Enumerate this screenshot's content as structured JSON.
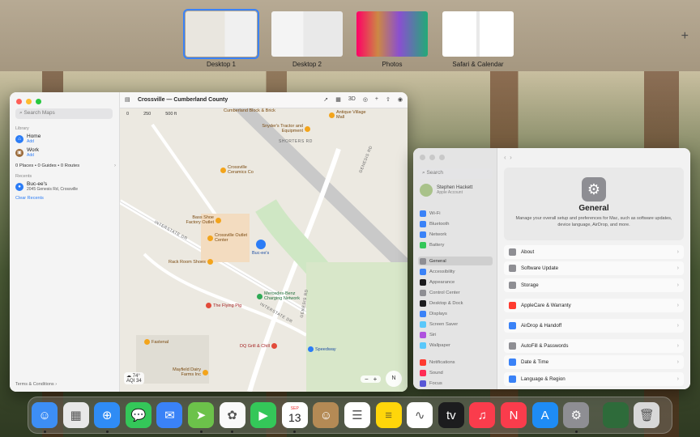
{
  "spaces": [
    {
      "label": "Desktop 1",
      "active": true
    },
    {
      "label": "Desktop 2",
      "active": false
    },
    {
      "label": "Photos",
      "active": false
    },
    {
      "label": "Safari & Calendar",
      "active": false
    }
  ],
  "add_space_icon": "+",
  "maps": {
    "search_placeholder": "Search Maps",
    "library_label": "Library",
    "home": {
      "label": "Home",
      "sub": "Add"
    },
    "work": {
      "label": "Work",
      "sub": "Add"
    },
    "counts": "0 Places • 0 Guides • 0 Routes",
    "recents_label": "Recents",
    "recent": {
      "label": "Buc-ee's",
      "sub": "2045 Genesis Rd, Crossville"
    },
    "clear_recents": "Clear Recents",
    "terms": "Terms & Conditions ›",
    "title": "Crossville — Cumberland County",
    "toolbar_3d": "3D",
    "scale": [
      "0",
      "250",
      "500 ft"
    ],
    "weather_temp": "74°",
    "weather_aqi": "AQI 34",
    "compass": "N",
    "zoom_minus": "−",
    "zoom_plus": "+",
    "pois": [
      {
        "label": "Cumberland Block & Brick",
        "kind": "orange"
      },
      {
        "label": "Antique Village Mall",
        "kind": "orange"
      },
      {
        "label": "Snyder's Tractor and Equipment",
        "kind": "orange"
      },
      {
        "label": "Crossville Ceramics Co",
        "kind": "orange"
      },
      {
        "label": "Bass Shoe Factory Outlet",
        "kind": "orange"
      },
      {
        "label": "Crossville Outlet Center",
        "kind": "orange"
      },
      {
        "label": "Buc-ee's",
        "kind": "blue"
      },
      {
        "label": "Rack Room Shoes",
        "kind": "orange"
      },
      {
        "label": "Mercedes-Benz Charging Network",
        "kind": "green"
      },
      {
        "label": "The Flying Pig",
        "kind": "red"
      },
      {
        "label": "Fastenal",
        "kind": "orange"
      },
      {
        "label": "DQ Grill & Chill",
        "kind": "red"
      },
      {
        "label": "Speedway",
        "kind": "blue"
      },
      {
        "label": "Mayfield Dairy Farms Inc",
        "kind": "orange"
      }
    ],
    "roads": [
      "INTERSTATE DR",
      "GENESIS RD",
      "INTERSTATE DR",
      "GENESIS RD",
      "SHORTERS RD"
    ]
  },
  "settings": {
    "search_placeholder": "Search",
    "user": {
      "name": "Stephen Hackett",
      "sub": "Apple Account"
    },
    "sidebar": [
      {
        "label": "Wi-Fi",
        "color": "#3a82f7"
      },
      {
        "label": "Bluetooth",
        "color": "#3a82f7"
      },
      {
        "label": "Network",
        "color": "#3a82f7"
      },
      {
        "label": "Battery",
        "color": "#34c759"
      },
      {
        "label": "General",
        "color": "#8e8e93",
        "selected": true
      },
      {
        "label": "Accessibility",
        "color": "#3a82f7"
      },
      {
        "label": "Appearance",
        "color": "#1c1c1e"
      },
      {
        "label": "Control Center",
        "color": "#8e8e93"
      },
      {
        "label": "Desktop & Dock",
        "color": "#1c1c1e"
      },
      {
        "label": "Displays",
        "color": "#3a82f7"
      },
      {
        "label": "Screen Saver",
        "color": "#5ac8fa"
      },
      {
        "label": "Siri",
        "color": "#af52de"
      },
      {
        "label": "Wallpaper",
        "color": "#5ac8fa"
      },
      {
        "label": "Notifications",
        "color": "#ff3b30"
      },
      {
        "label": "Sound",
        "color": "#ff2d55"
      },
      {
        "label": "Focus",
        "color": "#5856d6"
      }
    ],
    "title": "General",
    "description": "Manage your overall setup and preferences for Mac, such as software updates, device language, AirDrop, and more.",
    "rows": [
      {
        "label": "About",
        "color": "#8e8e93"
      },
      {
        "label": "Software Update",
        "color": "#8e8e93"
      },
      {
        "label": "Storage",
        "color": "#8e8e93"
      },
      {
        "label": "AppleCare & Warranty",
        "color": "#ff3b30"
      },
      {
        "label": "AirDrop & Handoff",
        "color": "#3a82f7"
      },
      {
        "label": "AutoFill & Passwords",
        "color": "#8e8e93"
      },
      {
        "label": "Date & Time",
        "color": "#3a82f7"
      },
      {
        "label": "Language & Region",
        "color": "#3a82f7"
      }
    ]
  },
  "dock": [
    {
      "name": "finder",
      "color": "#3d8ef5",
      "glyph": "☺",
      "running": true
    },
    {
      "name": "launchpad",
      "color": "#e8e8e8",
      "glyph": "▦",
      "running": false
    },
    {
      "name": "safari",
      "color": "#2f8cf5",
      "glyph": "⊕",
      "running": true
    },
    {
      "name": "messages",
      "color": "#34c759",
      "glyph": "💬",
      "running": false
    },
    {
      "name": "mail",
      "color": "#3a82f7",
      "glyph": "✉",
      "running": false
    },
    {
      "name": "maps",
      "color": "#6cc24a",
      "glyph": "➤",
      "running": true
    },
    {
      "name": "photos",
      "color": "#fafafa",
      "glyph": "✿",
      "running": true
    },
    {
      "name": "facetime",
      "color": "#34c759",
      "glyph": "▶",
      "running": false
    },
    {
      "name": "calendar",
      "color": "#ffffff",
      "glyph": "",
      "month": "SEP",
      "day": "13",
      "running": true
    },
    {
      "name": "contacts",
      "color": "#b48a55",
      "glyph": "☺",
      "running": false
    },
    {
      "name": "reminders",
      "color": "#ffffff",
      "glyph": "☰",
      "running": false
    },
    {
      "name": "notes",
      "color": "#ffd60a",
      "glyph": "≡",
      "running": false
    },
    {
      "name": "freeform",
      "color": "#ffffff",
      "glyph": "∿",
      "running": false
    },
    {
      "name": "apple-tv",
      "color": "#1c1c1e",
      "glyph": "tv",
      "running": false
    },
    {
      "name": "music",
      "color": "#fa3c4c",
      "glyph": "♫",
      "running": false
    },
    {
      "name": "news",
      "color": "#fa3c4c",
      "glyph": "N",
      "running": false
    },
    {
      "name": "app-store",
      "color": "#1e8cf5",
      "glyph": "A",
      "running": false
    },
    {
      "name": "system-settings",
      "color": "#8e8e93",
      "glyph": "⚙",
      "running": true
    },
    {
      "name": "downloads-stack",
      "color": "#2e6b3a",
      "glyph": "",
      "running": false
    },
    {
      "name": "trash",
      "color": "#d8d8d8",
      "glyph": "🗑",
      "running": false
    }
  ]
}
